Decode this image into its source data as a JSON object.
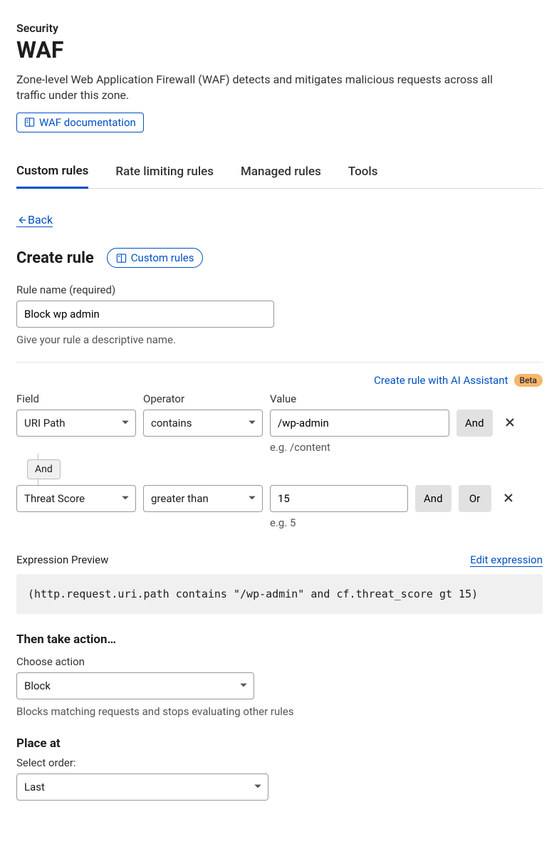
{
  "breadcrumb": "Security",
  "page_title": "WAF",
  "page_desc": "Zone-level Web Application Firewall (WAF) detects and mitigates malicious requests across all traffic under this zone.",
  "doc_link_label": "WAF documentation",
  "tabs": [
    {
      "label": "Custom rules",
      "active": true
    },
    {
      "label": "Rate limiting rules",
      "active": false
    },
    {
      "label": "Managed rules",
      "active": false
    },
    {
      "label": "Tools",
      "active": false
    }
  ],
  "back_label": "Back",
  "create_rule": {
    "title": "Create rule",
    "pill_label": "Custom rules",
    "rule_name_label": "Rule name (required)",
    "rule_name_value": "Block wp admin",
    "rule_name_help": "Give your rule a descriptive name."
  },
  "ai": {
    "link": "Create rule with AI Assistant",
    "badge": "Beta"
  },
  "cond_headers": {
    "field": "Field",
    "operator": "Operator",
    "value": "Value"
  },
  "conditions": [
    {
      "field": "URI Path",
      "operator": "contains",
      "value": "/wp-admin",
      "example": "e.g. /content",
      "buttons": [
        "And"
      ]
    },
    {
      "field": "Threat Score",
      "operator": "greater than",
      "value": "15",
      "example": "e.g. 5",
      "buttons": [
        "And",
        "Or"
      ]
    }
  ],
  "connector": "And",
  "expression": {
    "label": "Expression Preview",
    "edit": "Edit expression",
    "text": "(http.request.uri.path contains \"/wp-admin\" and cf.threat_score gt 15)"
  },
  "action": {
    "title": "Then take action…",
    "label": "Choose action",
    "value": "Block",
    "help": "Blocks matching requests and stops evaluating other rules"
  },
  "place": {
    "title": "Place at",
    "label": "Select order:",
    "value": "Last"
  }
}
